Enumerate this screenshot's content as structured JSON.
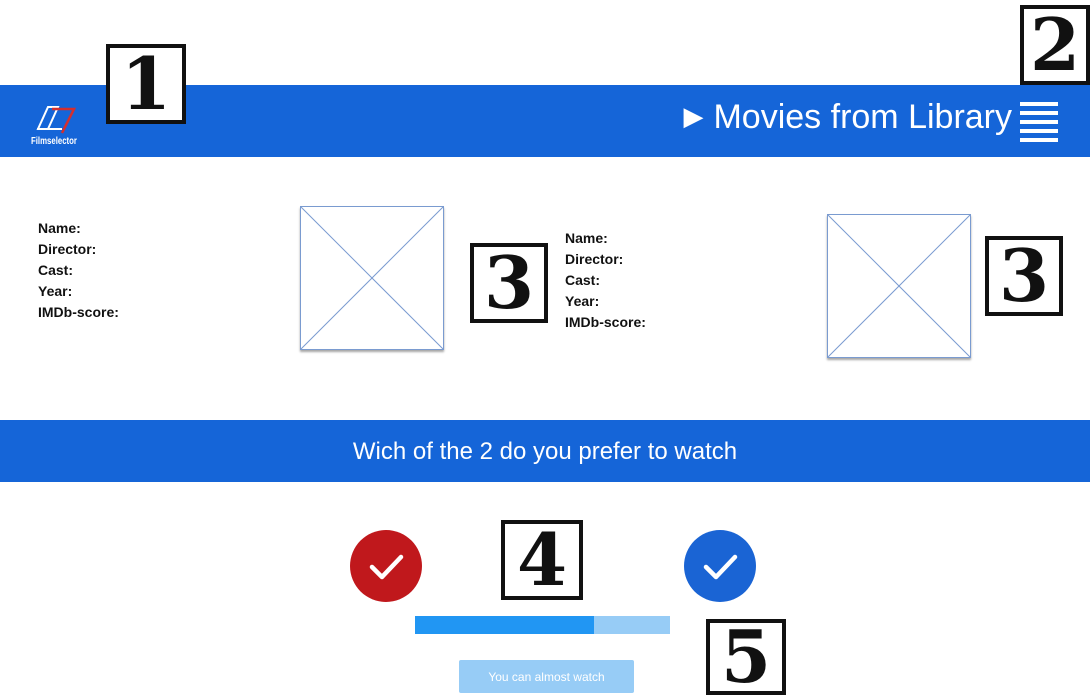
{
  "app": {
    "logo_text": "Filmselector"
  },
  "header": {
    "title": "Movies from Library",
    "arrow_glyph": "▶",
    "menu_icon": "hamburger-icon"
  },
  "movies": [
    {
      "labels": [
        "Name:",
        "Director:",
        "Cast:",
        "Year:",
        "IMDb-score:"
      ]
    },
    {
      "labels": [
        "Name:",
        "Director:",
        "Cast:",
        "Year:",
        "IMDb-score:"
      ]
    }
  ],
  "question": {
    "text": "Wich of the 2 do you prefer to watch"
  },
  "choices": [
    {
      "icon": "check-icon",
      "color": "#c0181c"
    },
    {
      "icon": "check-icon",
      "color": "#1a64d4"
    }
  ],
  "progress": {
    "fraction": 0.7
  },
  "watch_button": {
    "label": "You can almost watch"
  },
  "callouts": [
    "1",
    "2",
    "3",
    "3",
    "4",
    "5"
  ],
  "colors": {
    "brand_blue": "#1565d8",
    "progress_fill": "#2196f3",
    "progress_track": "#97ccf6"
  }
}
